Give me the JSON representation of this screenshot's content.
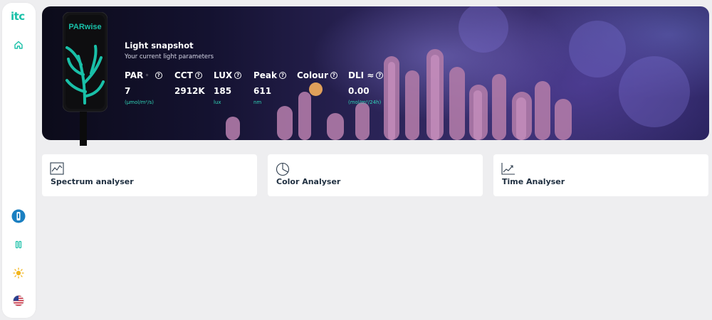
{
  "brand": {
    "logo_text": "itc",
    "accent": "#19c0a8"
  },
  "sidebar": {
    "items": [
      {
        "icon": "home-icon"
      },
      {
        "icon": "device-icon"
      },
      {
        "icon": "pause-icon"
      },
      {
        "icon": "sun-icon"
      },
      {
        "icon": "us-flag-icon"
      }
    ]
  },
  "device": {
    "label": "PARwise"
  },
  "snapshot": {
    "title": "Light snapshot",
    "subtitle": "Your current light parameters",
    "metrics": {
      "par": {
        "label": "PAR",
        "value": "7",
        "unit": "(μmol/m²/s)"
      },
      "cct": {
        "label": "CCT",
        "value": "2912K"
      },
      "lux": {
        "label": "LUX",
        "value": "185",
        "unit": "lux"
      },
      "peak": {
        "label": "Peak",
        "value": "611",
        "unit": "nm"
      },
      "colour": {
        "label": "Colour",
        "swatch": "#e0a05a"
      },
      "dli": {
        "label": "DLI ≈",
        "value": "0.00",
        "unit": "(mol/m²/24h)"
      }
    }
  },
  "cards": [
    {
      "label": "Spectrum analyser",
      "icon": "line-chart-icon"
    },
    {
      "label": "Color Analyser",
      "icon": "pie-chart-icon"
    },
    {
      "label": "Time Analyser",
      "icon": "trend-chart-icon"
    }
  ]
}
